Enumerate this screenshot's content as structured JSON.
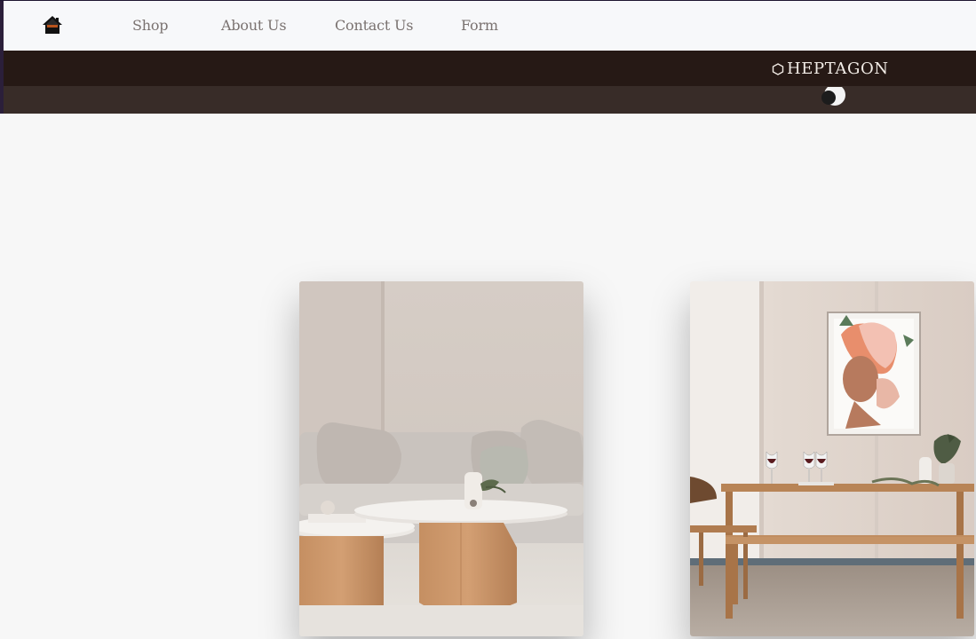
{
  "nav": {
    "home_icon": "home-icon",
    "links": [
      {
        "label": "Shop"
      },
      {
        "label": "About Us"
      },
      {
        "label": "Contact Us"
      },
      {
        "label": "Form"
      }
    ]
  },
  "brand": {
    "icon": "hexagon-icon",
    "name": "HEPTAGON"
  },
  "theme_toggle": {
    "icon": "moon-toggle-icon"
  },
  "gallery": {
    "items": [
      {
        "subject": "living-room-photo"
      },
      {
        "subject": "dining-room-photo"
      }
    ]
  },
  "colors": {
    "nav_background": "#f7f8fa",
    "nav_text": "#7a7270",
    "brand_band": "#261915",
    "sub_band": "#382c28",
    "page_background": "#f7f7f7",
    "brand_text": "#f2ece6"
  }
}
